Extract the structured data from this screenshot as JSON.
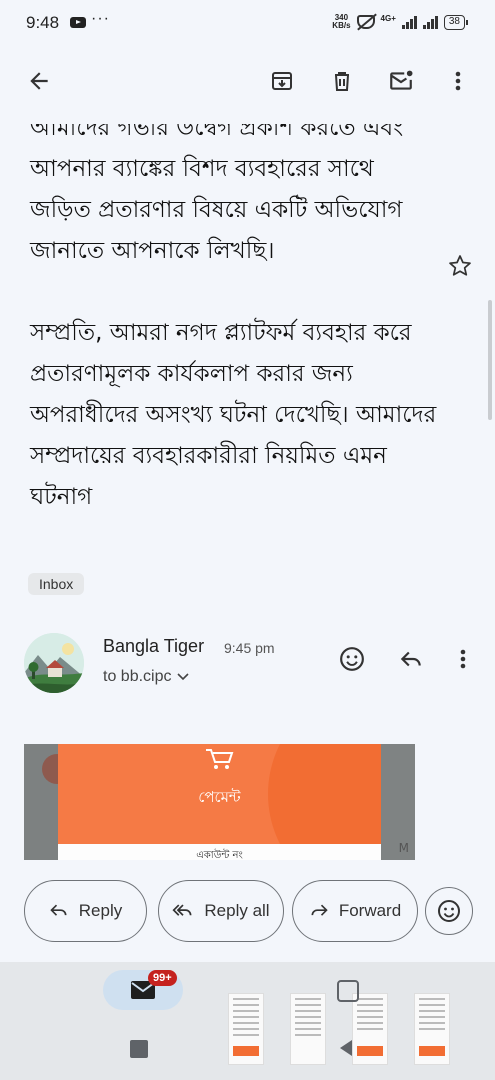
{
  "status_bar": {
    "time": "9:48",
    "speed_top": "340",
    "speed_bottom": "KB/s",
    "network": "4G+",
    "battery": "38"
  },
  "email": {
    "paragraph_1": "আমাদের গভীর উদ্বেগ প্রকাশ করতে এবং আপনার ব্যাঙ্কের বিশদ ব্যবহারের সাথে জড়িত প্রতারণার বিষয়ে একটি অভিযোগ জানাতে আপনাকে লিখছি।",
    "paragraph_2": "সম্প্রতি, আমরা নগদ প্ল্যাটফর্ম ব্যবহার করে প্রতারণামূলক কার্যকলাপ করার জন্য অপরাধীদের অসংখ্য ঘটনা দেখেছি। আমাদের সম্প্রদায়ের ব্যবহারকারীরা নিয়মিত এমন ঘটনাগ",
    "label_chip": "Inbox"
  },
  "sender": {
    "name": "Bangla Tiger",
    "time": "9:45 pm",
    "to": "to bb.cipc"
  },
  "embedded_image": {
    "title": "পেমেন্ট",
    "subtitle": "একাউন্ট নং",
    "edge_letter": "M"
  },
  "actions": {
    "reply": "Reply",
    "reply_all": "Reply all",
    "forward": "Forward"
  },
  "nav": {
    "mail_badge": "99+"
  }
}
